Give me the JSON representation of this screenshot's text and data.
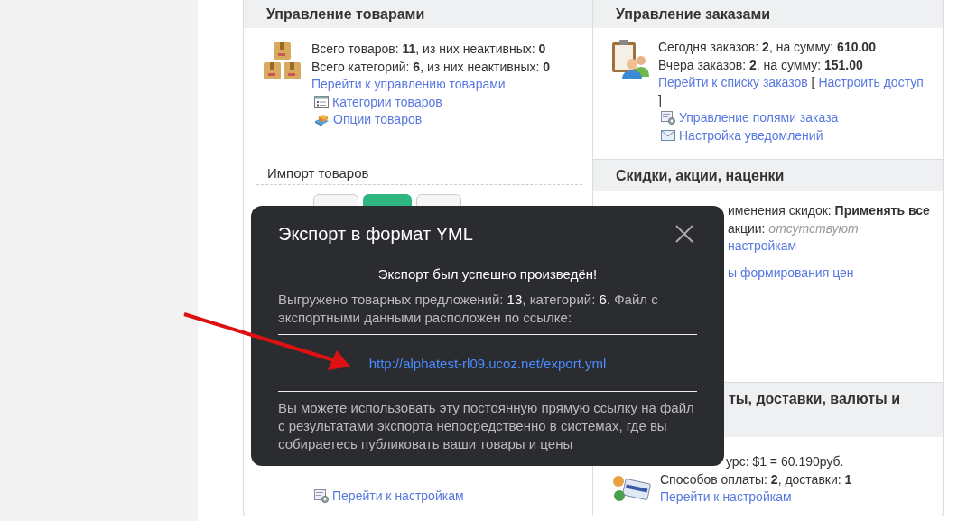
{
  "products_card": {
    "title": "Управление товарами",
    "stats": [
      "Всего товаров: **11**, из них неактивных: **0**",
      "Всего категорий: **6**, из них неактивных: **0**"
    ],
    "main_link": "Перейти к управлению товарами",
    "links": [
      {
        "kind": "list",
        "label": "Категории товаров"
      },
      {
        "kind": "options",
        "label": "Опции товаров"
      }
    ],
    "import": {
      "title": "Импорт товаров",
      "tabs": [
        {
          "selected": false
        },
        {
          "selected": true
        },
        {
          "selected": false
        }
      ]
    },
    "settings_link": "Перейти к настройкам"
  },
  "orders_card": {
    "title": "Управление заказами",
    "stats": [
      "Сегодня заказов: **2**, на сумму: **610.00**",
      "Вчера заказов: **2**, на сумму: **151.00**"
    ],
    "list_link": "Перейти к списку заказов",
    "bracket_open": "[",
    "access_link": "Настроить доступ",
    "bracket_close": "]",
    "links": [
      {
        "kind": "fields",
        "label": "Управление полями заказа"
      },
      {
        "kind": "mail",
        "label": "Настройка уведомлений"
      }
    ]
  },
  "discounts_card": {
    "title": "Скидки, акции, наценки",
    "lines": [
      {
        "kind": "text",
        "text": "именения скидок: **Применять все**"
      },
      {
        "kind": "text",
        "text": "акции: *отсутствуют*"
      },
      {
        "kind": "link",
        "text": "настройкам"
      },
      {
        "kind": "link",
        "text": "ы формирования цен"
      }
    ]
  },
  "payments_card": {
    "title": "ты, доставки, валюты и",
    "lines": [
      {
        "kind": "text",
        "text": "урс: $1 = 60.190руб."
      }
    ],
    "stats": [
      "Способов оплаты: **2**, доставки: **1**"
    ],
    "link": "Перейти к настройкам"
  },
  "modal": {
    "title": "Экспорт в формат YML",
    "headline": "Экспорт был успешно произведён!",
    "summary": "Выгружено товарных предложений: **13**, категорий: **6**. Файл с экспортными данными расположен по ссылке:",
    "link": "http://alphatest-rl09.ucoz.net/export.yml",
    "note": "Вы можете использовать эту постоянную прямую ссылку на файл с результатами экспорта непосредственно в системах, где вы собираетесь публиковать ваши товары и цены"
  }
}
